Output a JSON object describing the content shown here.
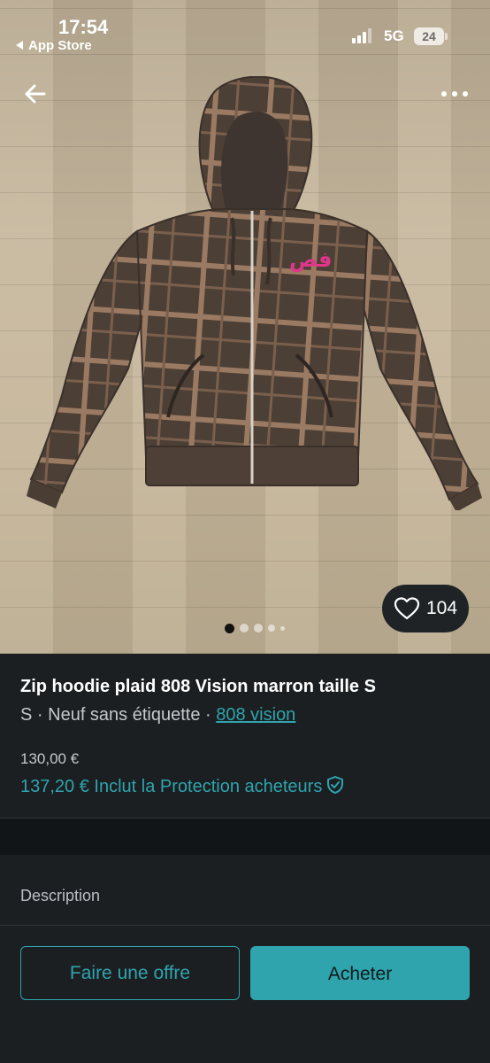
{
  "status_bar": {
    "time": "17:54",
    "back_app_label": "App Store",
    "network": "5G",
    "battery": "24"
  },
  "nav": {
    "back_icon": "arrow-left-icon",
    "more_icon": "more-horizontal-icon"
  },
  "photo": {
    "subject": "hoodie",
    "logo_text": "فص",
    "likes": "104",
    "carousel_total": 5,
    "carousel_active_index": 0
  },
  "listing": {
    "title": "Zip hoodie plaid 808 Vision marron taille S",
    "size": "S",
    "sep1": " · ",
    "condition": "Neuf sans étiquette",
    "sep2": " · ",
    "brand": "808 vision",
    "price": "130,00 €",
    "price_with_protection": "137,20 € Inclut la Protection acheteurs"
  },
  "description": {
    "label": "Description"
  },
  "actions": {
    "offer_label": "Faire une offre",
    "buy_label": "Acheter"
  },
  "colors": {
    "accent": "#2fa4ad",
    "background": "#1b1f22"
  }
}
